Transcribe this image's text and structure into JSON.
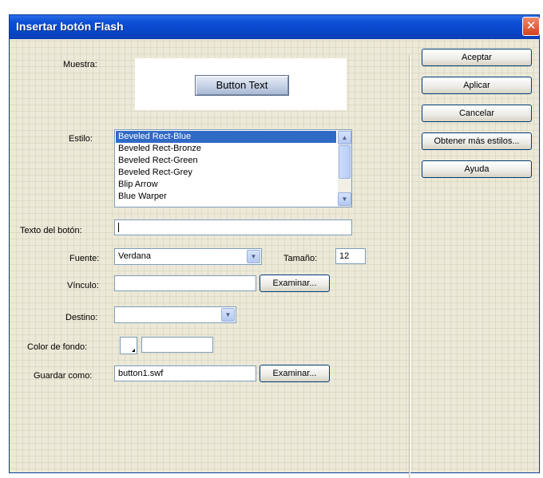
{
  "window": {
    "title": "Insertar botón Flash",
    "close_glyph": "✕"
  },
  "labels": {
    "muestra": "Muestra:",
    "estilo": "Estilo:",
    "texto_boton": "Texto del botón:",
    "fuente": "Fuente:",
    "tamano": "Tamaño:",
    "vinculo": "Vínculo:",
    "destino": "Destino:",
    "color_fondo": "Color de fondo:",
    "guardar_como": "Guardar como:"
  },
  "preview": {
    "button_text": "Button Text"
  },
  "style_list": {
    "items": [
      "Beveled Rect-Blue",
      "Beveled Rect-Bronze",
      "Beveled Rect-Green",
      "Beveled Rect-Grey",
      "Blip Arrow",
      "Blue Warper"
    ],
    "selected_index": 0,
    "scroll_up_glyph": "▲",
    "scroll_down_glyph": "▼"
  },
  "fields": {
    "texto_boton": "",
    "fuente": "Verdana",
    "tamano": "12",
    "vinculo": "",
    "destino": "",
    "color_fondo": "",
    "guardar_como": "button1.swf",
    "combo_arrow_glyph": "▼"
  },
  "buttons": {
    "examinar_vinculo": "Examinar...",
    "examinar_guardar": "Examinar...",
    "aceptar": "Aceptar",
    "aplicar": "Aplicar",
    "cancelar": "Cancelar",
    "obtener_mas": "Obtener más estilos...",
    "ayuda": "Ayuda"
  }
}
